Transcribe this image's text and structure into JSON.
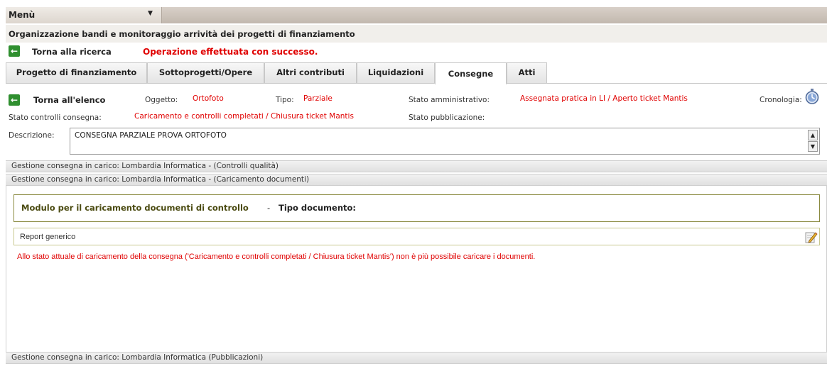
{
  "menu": {
    "label": "Menù",
    "arrow": "▼"
  },
  "page_title": "Organizzazione bandi e monitoraggio arrività dei progetti di finanziamento",
  "back_search": {
    "label": "Torna alla ricerca",
    "message": "Operazione effettuata con successo."
  },
  "tabs": [
    {
      "label": "Progetto di finanziamento"
    },
    {
      "label": "Sottoprogetti/Opere"
    },
    {
      "label": "Altri contributi"
    },
    {
      "label": "Liquidazioni"
    },
    {
      "label": "Consegne"
    },
    {
      "label": "Atti"
    }
  ],
  "active_tab": "Consegne",
  "detail": {
    "back_list": "Torna all'elenco",
    "oggetto_label": "Oggetto:",
    "oggetto_value": "Ortofoto",
    "tipo_label": "Tipo:",
    "tipo_value": "Parziale",
    "stato_amm_label": "Stato amministrativo:",
    "stato_amm_value": "Assegnata pratica in LI / Aperto ticket Mantis",
    "cronologia_label": "Cronologia:",
    "stato_controlli_label": "Stato controlli consegna:",
    "stato_controlli_value": "Caricamento e controlli completati / Chiusura ticket Mantis",
    "stato_pub_label": "Stato pubblicazione:",
    "descrizione_label": "Descrizione:",
    "descrizione_value": "CONSEGNA PARZIALE PROVA ORTOFOTO"
  },
  "sections": [
    "Gestione consegna in carico: Lombardia Informatica - (Controlli qualità)",
    "Gestione consegna in carico: Lombardia Informatica - (Caricamento documenti)",
    "Gestione consegna in carico: Lombardia Informatica (Pubblicazioni)"
  ],
  "module": {
    "title": "Modulo per il caricamento documenti di controllo",
    "separator": "-",
    "doc_type_label": "Tipo documento:",
    "report_label": "Report generico",
    "warning": "Allo stato attuale di caricamento della consegna ('Caricamento e controlli completati / Chiusura ticket Mantis') non è più possibile caricare i documenti."
  },
  "colors": {
    "error_red": "#e00000",
    "back_green": "#2f8f2f"
  },
  "icons": {
    "back": "arrow-left-icon",
    "chronology": "stopwatch-icon",
    "edit": "pencil-edit-icon"
  }
}
